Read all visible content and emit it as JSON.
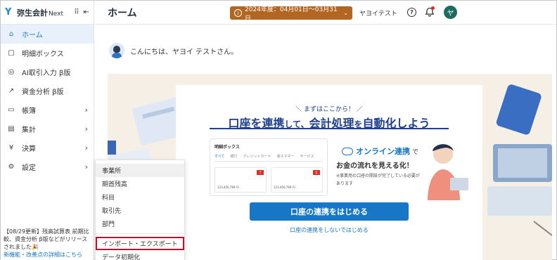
{
  "app": {
    "name": "弥生会計",
    "name_suffix": "Next"
  },
  "sidebar": {
    "items": [
      {
        "label": "ホーム",
        "icon": "home-icon",
        "active": true
      },
      {
        "label": "明細ボックス",
        "icon": "box-icon"
      },
      {
        "label": "AI取引入力 β版",
        "icon": "eye-icon"
      },
      {
        "label": "資金分析 β版",
        "icon": "chart-icon"
      },
      {
        "label": "帳簿",
        "icon": "book-icon",
        "has_children": true
      },
      {
        "label": "集計",
        "icon": "ledger-icon",
        "has_children": true
      },
      {
        "label": "決算",
        "icon": "yen-icon",
        "has_children": true
      },
      {
        "label": "設定",
        "icon": "gear-icon",
        "has_children": true
      }
    ],
    "news": "【08/29更新】残高試算表 前期比較、資金分析 β版などがリリースされました🎉",
    "news_more": "新機能・改善点の詳細はこちら"
  },
  "header": {
    "title": "ホーム",
    "fiscal_year": "2024年度：04月01日〜03月31日",
    "user_name": "ヤヨイテスト",
    "avatar_initial": "ヤ"
  },
  "greeting": "こんにちは、ヤヨイ テストさん。",
  "banner": {
    "sub": "＼ まずはここから！ ／",
    "title_a": "口座を連携",
    "title_b": "して、",
    "title_c": "会計処理",
    "title_d": "を",
    "title_e": "自動化しよう",
    "mini_title": "明細ボックス",
    "mini_tabs": [
      "すべて",
      "銀行",
      "クレジットカード",
      "電子マネー",
      "サービス"
    ],
    "mini_amount": "123,456,789 円",
    "mini_badges": [
      "7",
      "6"
    ],
    "cloud_label": "オンライン連携",
    "cloud_suffix": "で",
    "flow_text": "お金の流れを見える化！",
    "note": "※事業用の口座の開設が完了している必要があります",
    "connect_button": "口座の連携をはじめる",
    "skip_link": "口座の連携をしないではじめる"
  },
  "menu": {
    "items_top": [
      "事業所",
      "期首残高",
      "科目",
      "取引先",
      "部門"
    ],
    "items_bottom": [
      "インポート・エクスポート",
      "データ初期化"
    ]
  },
  "colors": {
    "accent": "#1677c9",
    "fiscal_year_bg": "#b36622",
    "highlight_border": "#c0102a"
  }
}
